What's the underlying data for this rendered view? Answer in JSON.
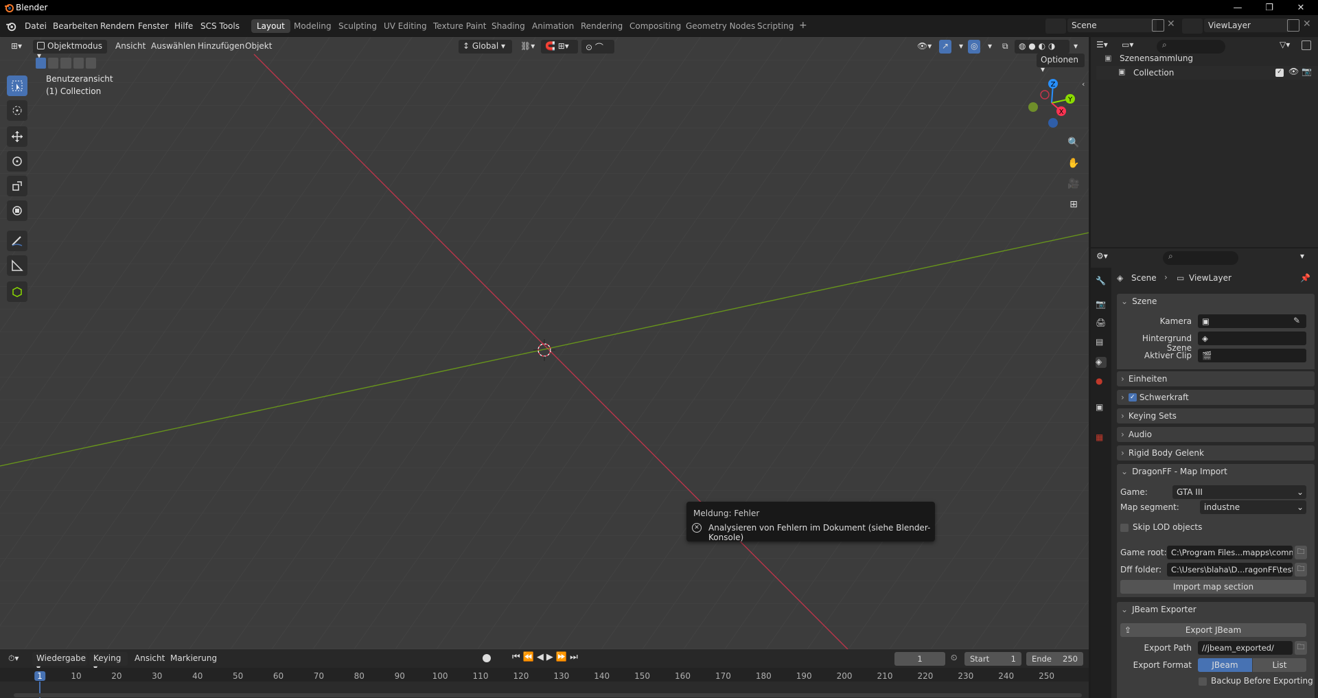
{
  "window": {
    "title": "Blender"
  },
  "menu": {
    "items": [
      "Datei",
      "Bearbeiten",
      "Rendern",
      "Fenster",
      "Hilfe",
      "SCS Tools"
    ]
  },
  "workspaces": [
    "Layout",
    "Modeling",
    "Sculpting",
    "UV Editing",
    "Texture Paint",
    "Shading",
    "Animation",
    "Rendering",
    "Compositing",
    "Geometry Nodes",
    "Scripting"
  ],
  "active_workspace": "Layout",
  "scene_field": "Scene",
  "viewlayer_field": "ViewLayer",
  "viewport": {
    "mode": "Objektmodus",
    "menus": [
      "Ansicht",
      "Auswählen",
      "Hinzufügen",
      "Objekt"
    ],
    "orientation": "Global",
    "options": "Optionen",
    "view_name": "Benutzeransicht",
    "collection_name": "(1) Collection",
    "gizmo_axes": [
      "Z",
      "Y",
      "X"
    ]
  },
  "outliner": {
    "root": "Szenensammlung",
    "child": "Collection"
  },
  "properties": {
    "breadcrumb": [
      "Scene",
      "ViewLayer"
    ],
    "scene_panel": "Szene",
    "fields": [
      {
        "label": "Kamera",
        "value": ""
      },
      {
        "label": "Hintergrund Szene",
        "value": ""
      },
      {
        "label": "Aktiver Clip",
        "value": ""
      }
    ],
    "collapsed_panels": [
      "Einheiten",
      "Schwerkraft",
      "Keying Sets",
      "Audio",
      "Rigid Body Gelenk"
    ],
    "gravity_checked": true,
    "dragonff": {
      "title": "DragonFF - Map Import",
      "game_label": "Game:",
      "game_value": "GTA III",
      "segment_label": "Map segment:",
      "segment_value": "industne",
      "skip_lod": "Skip LOD objects",
      "game_root_label": "Game root:",
      "game_root_value": "C:\\Program Files...mapps\\common\\",
      "dff_label": "Dff folder:",
      "dff_value": "C:\\Users\\blaha\\D...ragonFF\\tests\\dff",
      "import_button": "Import map section"
    },
    "jbeam": {
      "title": "JBeam Exporter",
      "export_button": "Export JBeam",
      "path_label": "Export Path",
      "path_value": "//jbeam_exported/",
      "format_label": "Export Format",
      "format_options": [
        "JBeam",
        "List"
      ],
      "format_selected": "JBeam",
      "backup_label": "Backup Before Exporting"
    }
  },
  "timeline": {
    "menus": [
      "Wiedergabe",
      "Keying",
      "Ansicht",
      "Markierung"
    ],
    "current_frame": "1",
    "start_label": "Start",
    "start_value": "1",
    "end_label": "Ende",
    "end_value": "250",
    "ticks": [
      "1",
      "10",
      "20",
      "30",
      "40",
      "50",
      "60",
      "70",
      "80",
      "90",
      "100",
      "110",
      "120",
      "130",
      "140",
      "150",
      "160",
      "170",
      "180",
      "190",
      "200",
      "210",
      "220",
      "230",
      "240",
      "250"
    ]
  },
  "report": {
    "title": "Meldung: Fehler",
    "message": "Analysieren von Fehlern im Dokument (siehe Blender-Konsole)"
  },
  "colors": {
    "accent": "#4772b3",
    "x_axis": "#ff3352",
    "y_axis": "#8bdc00",
    "z_axis": "#2890ff"
  }
}
